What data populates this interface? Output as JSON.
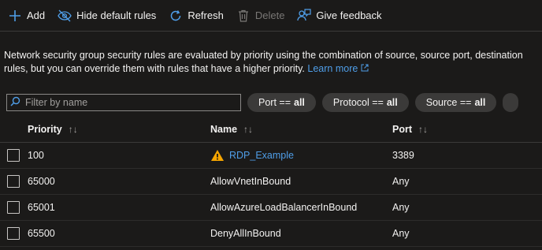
{
  "toolbar": {
    "add_label": "Add",
    "hide_default_label": "Hide default rules",
    "refresh_label": "Refresh",
    "delete_label": "Delete",
    "feedback_label": "Give feedback"
  },
  "description": {
    "text_line1": "Network security group security rules are evaluated by priority using the combination of source, source port, destination",
    "text_line2": "rules, but you can override them with rules that have a higher priority. ",
    "learn_more": "Learn more"
  },
  "filters": {
    "search_placeholder": "Filter by name",
    "pills": [
      {
        "key": "Port ==",
        "value": "all"
      },
      {
        "key": "Protocol ==",
        "value": "all"
      },
      {
        "key": "Source ==",
        "value": "all"
      }
    ]
  },
  "table": {
    "columns": [
      "Priority",
      "Name",
      "Port"
    ],
    "rows": [
      {
        "priority": "100",
        "name": "RDP_Example",
        "port": "3389",
        "warning": true
      },
      {
        "priority": "65000",
        "name": "AllowVnetInBound",
        "port": "Any",
        "warning": false
      },
      {
        "priority": "65001",
        "name": "AllowAzureLoadBalancerInBound",
        "port": "Any",
        "warning": false
      },
      {
        "priority": "65500",
        "name": "DenyAllInBound",
        "port": "Any",
        "warning": false
      }
    ]
  },
  "colors": {
    "background": "#1b1a19",
    "link": "#4f9ee8",
    "accent": "#4f9ee8",
    "warning": "#f7a600"
  }
}
